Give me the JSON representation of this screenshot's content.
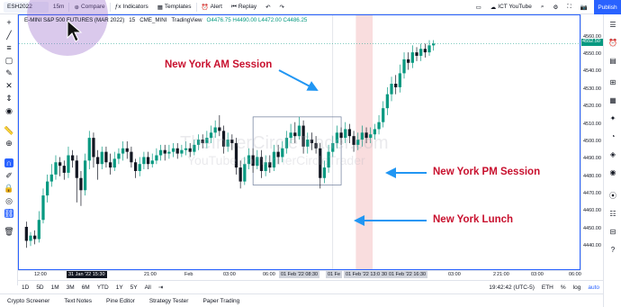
{
  "header": {
    "symbol": "ESH2022",
    "interval": "15m",
    "compare_label": "Compare",
    "indicators_label": "Indicators",
    "templates_label": "Templates",
    "alert_label": "Alert",
    "replay_label": "Replay",
    "profile_label": "ICT YouTube",
    "publish_label": "Publish"
  },
  "legend": {
    "title": "E-MINI S&P 500 FUTURES (MAR 2022)",
    "interval": "15",
    "exchange": "CME_MINI",
    "source": "TradingView",
    "ohlc": "O4476.75 H4490.00 L4472.00 C4486.25"
  },
  "watermark": {
    "line1": "TheInnerCircleTrader.com",
    "line2": "YouTube.com/InnerCircleTrader"
  },
  "annotations": {
    "am": "New York AM Session",
    "pm": "New York PM Session",
    "lunch": "New York Lunch"
  },
  "price_axis": {
    "labels": [
      "4560.00",
      "4550.00",
      "4540.00",
      "4530.00",
      "4520.00",
      "4510.00",
      "4500.00",
      "4490.00",
      "4480.00",
      "4470.00",
      "4460.00",
      "4450.00",
      "4440.00"
    ],
    "current_price": "4552.50"
  },
  "time_axis": {
    "labels": [
      "12:00",
      "21:00",
      "Feb",
      "03:00",
      "06:00",
      "21:00",
      "03:00",
      "21:00",
      "2",
      "03:00",
      "06:00"
    ],
    "highlight_labels": [
      "31 Jan '22  15:30",
      "01 Feb '22  08:30",
      "01 Fe",
      "01 Feb '22  13:00",
      "30",
      "01 Feb '22  16:30"
    ]
  },
  "bottom": {
    "ranges": [
      "1D",
      "5D",
      "1M",
      "3M",
      "6M",
      "YTD",
      "1Y",
      "5Y",
      "All"
    ],
    "clock": "19:42:42 (UTC-5)",
    "session": "ETH",
    "pct": "%",
    "log": "log",
    "auto": "auto",
    "tabs": [
      "Crypto Screener",
      "Text Notes",
      "Pine Editor",
      "Strategy Tester",
      "Paper Trading"
    ]
  },
  "colors": {
    "up": "#089981",
    "down": "#131722",
    "accent": "#2962ff",
    "annotation": "#c8102e",
    "lunch_zone": "#f7d4d6"
  },
  "chart_data": {
    "type": "candlestick",
    "symbol": "ESH2022",
    "timeframe": "15m",
    "ylim": [
      4436,
      4566
    ],
    "lunch_zone_index": [
      79,
      82
    ],
    "box": {
      "from_index": 54,
      "to_index": 75,
      "top": 4515,
      "bottom": 4476
    },
    "candles": [
      [
        4452,
        4444,
        4455,
        4440
      ],
      [
        4444,
        4447,
        4449,
        4441
      ],
      [
        4447,
        4445,
        4450,
        4442
      ],
      [
        4445,
        4456,
        4461,
        4443
      ],
      [
        4456,
        4470,
        4474,
        4454
      ],
      [
        4470,
        4478,
        4482,
        4466
      ],
      [
        4478,
        4482,
        4488,
        4475
      ],
      [
        4482,
        4489,
        4493,
        4479
      ],
      [
        4489,
        4487,
        4492,
        4481
      ],
      [
        4487,
        4483,
        4490,
        4479
      ],
      [
        4483,
        4493,
        4498,
        4480
      ],
      [
        4493,
        4490,
        4496,
        4486
      ],
      [
        4490,
        4480,
        4493,
        4466
      ],
      [
        4480,
        4473,
        4484,
        4464
      ],
      [
        4473,
        4490,
        4494,
        4470
      ],
      [
        4490,
        4503,
        4507,
        4485
      ],
      [
        4503,
        4492,
        4506,
        4486
      ],
      [
        4492,
        4488,
        4496,
        4479
      ],
      [
        4488,
        4495,
        4498,
        4485
      ],
      [
        4495,
        4489,
        4498,
        4486
      ],
      [
        4489,
        4486,
        4494,
        4482
      ],
      [
        4486,
        4491,
        4495,
        4484
      ],
      [
        4491,
        4494,
        4497,
        4488
      ],
      [
        4494,
        4497,
        4501,
        4490
      ],
      [
        4497,
        4495,
        4501,
        4491
      ],
      [
        4495,
        4489,
        4498,
        4486
      ],
      [
        4489,
        4484,
        4491,
        4480
      ],
      [
        4484,
        4488,
        4492,
        4481
      ],
      [
        4488,
        4492,
        4495,
        4485
      ],
      [
        4492,
        4488,
        4495,
        4485
      ],
      [
        4488,
        4490,
        4494,
        4486
      ],
      [
        4490,
        4493,
        4497,
        4488
      ],
      [
        4493,
        4496,
        4499,
        4490
      ],
      [
        4496,
        4494,
        4499,
        4490
      ],
      [
        4494,
        4495,
        4499,
        4491
      ],
      [
        4495,
        4497,
        4500,
        4492
      ],
      [
        4497,
        4494,
        4500,
        4491
      ],
      [
        4494,
        4496,
        4499,
        4492
      ],
      [
        4496,
        4497,
        4501,
        4493
      ],
      [
        4497,
        4495,
        4500,
        4492
      ],
      [
        4495,
        4499,
        4502,
        4493
      ],
      [
        4499,
        4502,
        4505,
        4496
      ],
      [
        4502,
        4500,
        4505,
        4497
      ],
      [
        4500,
        4503,
        4507,
        4497
      ],
      [
        4503,
        4506,
        4510,
        4500
      ],
      [
        4506,
        4509,
        4513,
        4503
      ],
      [
        4509,
        4507,
        4516,
        4504
      ],
      [
        4507,
        4498,
        4510,
        4494
      ],
      [
        4498,
        4502,
        4506,
        4495
      ],
      [
        4502,
        4500,
        4505,
        4496
      ],
      [
        4500,
        4486,
        4503,
        4482
      ],
      [
        4486,
        4478,
        4490,
        4474
      ],
      [
        4478,
        4488,
        4492,
        4476
      ],
      [
        4488,
        4493,
        4497,
        4485
      ],
      [
        4493,
        4487,
        4497,
        4483
      ],
      [
        4487,
        4492,
        4496,
        4485
      ],
      [
        4492,
        4484,
        4496,
        4480
      ],
      [
        4484,
        4489,
        4493,
        4481
      ],
      [
        4489,
        4486,
        4493,
        4483
      ],
      [
        4486,
        4495,
        4499,
        4484
      ],
      [
        4495,
        4492,
        4499,
        4488
      ],
      [
        4492,
        4497,
        4501,
        4489
      ],
      [
        4497,
        4503,
        4507,
        4494
      ],
      [
        4503,
        4506,
        4511,
        4500
      ],
      [
        4506,
        4504,
        4512,
        4500
      ],
      [
        4504,
        4510,
        4515,
        4502
      ],
      [
        4510,
        4498,
        4513,
        4494
      ],
      [
        4498,
        4502,
        4506,
        4494
      ],
      [
        4502,
        4500,
        4506,
        4496
      ],
      [
        4500,
        4497,
        4504,
        4494
      ],
      [
        4497,
        4480,
        4500,
        4474
      ],
      [
        4480,
        4486,
        4490,
        4477
      ],
      [
        4486,
        4495,
        4499,
        4483
      ],
      [
        4495,
        4500,
        4504,
        4492
      ],
      [
        4500,
        4506,
        4510,
        4497
      ],
      [
        4506,
        4503,
        4509,
        4499
      ],
      [
        4503,
        4508,
        4512,
        4500
      ],
      [
        4508,
        4504,
        4511,
        4500
      ],
      [
        4504,
        4499,
        4507,
        4495
      ],
      [
        4499,
        4502,
        4506,
        4496
      ],
      [
        4502,
        4506,
        4510,
        4498
      ],
      [
        4506,
        4503,
        4509,
        4500
      ],
      [
        4503,
        4505,
        4509,
        4500
      ],
      [
        4505,
        4508,
        4511,
        4502
      ],
      [
        4508,
        4512,
        4516,
        4505
      ],
      [
        4512,
        4520,
        4524,
        4509
      ],
      [
        4520,
        4528,
        4532,
        4516
      ],
      [
        4528,
        4534,
        4538,
        4524
      ],
      [
        4534,
        4532,
        4539,
        4528
      ],
      [
        4532,
        4540,
        4545,
        4529
      ],
      [
        4540,
        4548,
        4552,
        4537
      ],
      [
        4548,
        4546,
        4552,
        4542
      ],
      [
        4546,
        4552,
        4556,
        4543
      ],
      [
        4552,
        4550,
        4555,
        4547
      ],
      [
        4550,
        4554,
        4557,
        4547
      ],
      [
        4554,
        4552,
        4557,
        4549
      ],
      [
        4552,
        4556,
        4559,
        4550
      ],
      [
        4556,
        4557,
        4559,
        4553
      ]
    ]
  }
}
